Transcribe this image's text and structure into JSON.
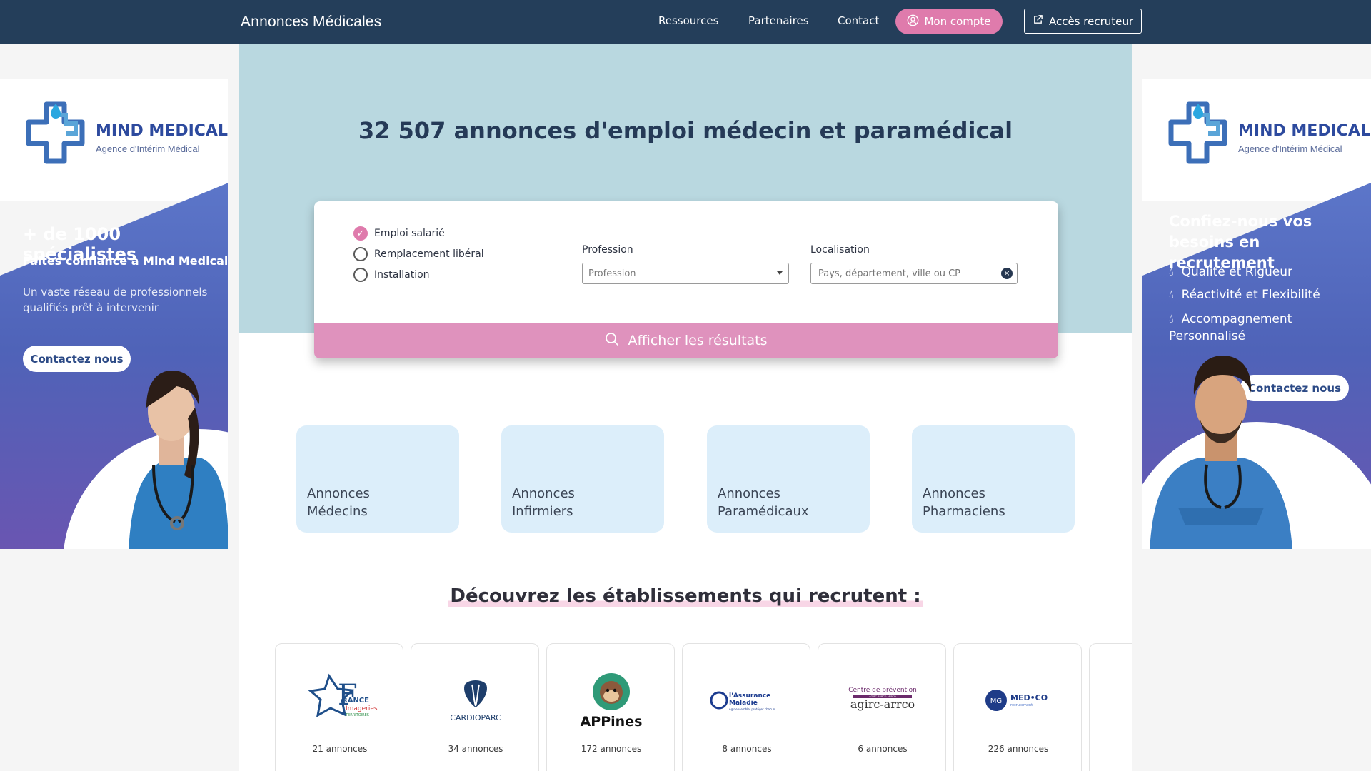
{
  "nav": {
    "brand_part1": "Annonces",
    "brand_part2": " Médicales",
    "links": [
      "Ressources",
      "Partenaires",
      "Contact"
    ],
    "account_label": "Mon compte",
    "recruiter_label": "Accès recruteur"
  },
  "hero": {
    "count": "32 507 annonces",
    "suffix": " d'emploi médecin et paramédical"
  },
  "search": {
    "options": [
      {
        "label": "Emploi salarié",
        "checked": true
      },
      {
        "label": "Remplacement libéral",
        "checked": false
      },
      {
        "label": "Installation",
        "checked": false
      }
    ],
    "profession_label": "Profession",
    "profession_value": "Profession",
    "location_label": "Localisation",
    "location_placeholder": "Pays, département, ville ou CP",
    "submit_label": "Afficher les résultats"
  },
  "categories": [
    {
      "line1": "Annonces",
      "line2": "Médecins"
    },
    {
      "line1": "Annonces",
      "line2": "Infirmiers"
    },
    {
      "line1": "Annonces",
      "line2": "Paramédicaux"
    },
    {
      "line1": "Annonces",
      "line2": "Pharmaciens"
    }
  ],
  "establishments": {
    "title": "Découvrez les établissements qui recrutent :",
    "items": [
      {
        "logo_text_1": "RANCE",
        "logo_text_2": "Imageries",
        "logo_text_3": "TERRITOIRES",
        "count": "21 annonces"
      },
      {
        "logo_text_1": "CARDIOPARC",
        "count": "34 annonces"
      },
      {
        "logo_text_1": "APPines",
        "count": "172 annonces"
      },
      {
        "logo_text_1": "l'Assurance",
        "logo_text_2": "Maladie",
        "logo_text_3": "Agir ensemble, protéger chacun",
        "count": "8 annonces"
      },
      {
        "logo_text_1": "Centre de prévention",
        "logo_text_2": "AGIRC-ARRCO ARRCO",
        "logo_text_3": "agirc-arrco",
        "count": "6 annonces"
      },
      {
        "logo_text_1": "MED•CO",
        "logo_text_2": "recrutement",
        "count": "226 annonces"
      }
    ]
  },
  "ad_left": {
    "brand": "MIND MEDICAL",
    "brand_sub": "Agence d'Intérim Médical",
    "headline": "+ de 1000 spécialistes",
    "subheadline": "Faites confiance à Mind Medical",
    "body": "Un vaste réseau de professionnels qualifiés prêt à intervenir",
    "cta": "Contactez nous"
  },
  "ad_right": {
    "brand": "MIND MEDICAL",
    "brand_sub": "Agence d'Intérim Médical",
    "headline": "Confiez-nous vos besoins en recrutement",
    "bullets": [
      "Qualité et Rigueur",
      "Réactivité et Flexibilité",
      "Accompagnement Personnalisé"
    ],
    "cta": "Contactez nous"
  },
  "colors": {
    "nav_bg": "#243e5a",
    "accent_pink": "#df7bac",
    "hero_bg": "#b9d8e0",
    "card_bg": "#dceefa"
  }
}
